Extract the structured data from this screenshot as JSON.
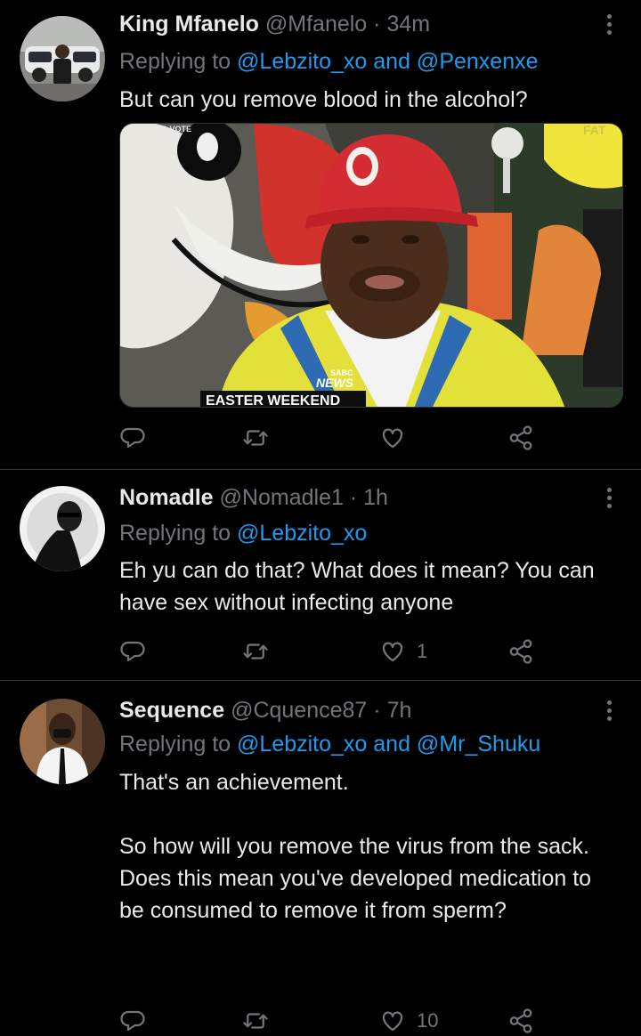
{
  "tweets": [
    {
      "name": "King Mfanelo",
      "handle": "@Mfanelo",
      "time": "34m",
      "replying_prefix": "Replying to ",
      "replying_users": "@Lebzito_xo and @Penxenxe",
      "text": "But can you remove blood in the alcohol?",
      "media": {
        "label_top": "DAYS TO VOTE",
        "badge_top": "SABC",
        "badge_bottom": "NEWS",
        "caption": "EASTER WEEKEND",
        "sign_text": "FAT"
      },
      "likes": ""
    },
    {
      "name": "Nomadle",
      "handle": "@Nomadle1",
      "time": "1h",
      "replying_prefix": "Replying to ",
      "replying_users": "@Lebzito_xo",
      "text": "Eh yu can do that? What does it mean? You can have sex without infecting anyone",
      "likes": "1"
    },
    {
      "name": "Sequence",
      "handle": "@Cquence87",
      "time": "7h",
      "replying_prefix": "Replying to ",
      "replying_users": "@Lebzito_xo and @Mr_Shuku",
      "text": "That's an achievement.\n\nSo how will you remove the virus from the sack.\nDoes this mean you've developed medication to be consumed to remove it from sperm?",
      "likes": "10"
    }
  ],
  "separator": "·",
  "icons": [
    "reply-icon",
    "retweet-icon",
    "like-icon",
    "share-icon",
    "more-icon"
  ],
  "colors": {
    "background": "#000000",
    "text": "#e7e9ea",
    "muted": "#71767b",
    "link": "#1d9bf0",
    "divider": "#2f3336"
  }
}
